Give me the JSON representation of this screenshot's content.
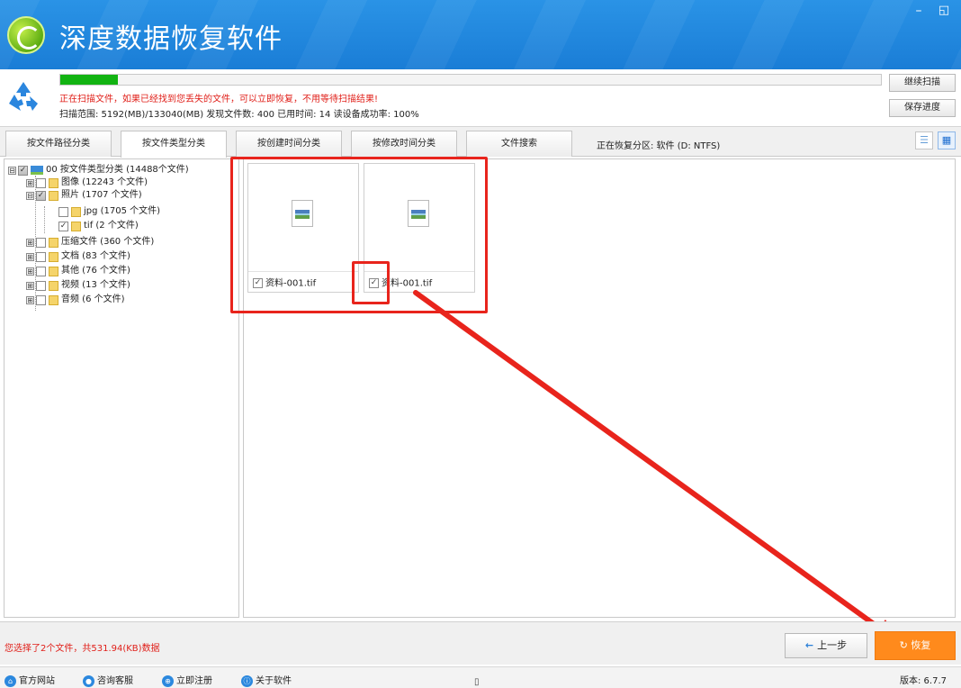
{
  "window": {
    "title": "深度数据恢复软件",
    "minimize_glyph": "–",
    "restore_glyph": "◱"
  },
  "scan": {
    "progress_percent": 7,
    "line1": "正在扫描文件，如果已经找到您丢失的文件，可以立即恢复，不用等待扫描结果!",
    "line2": "扫描范围: 5192(MB)/133040(MB)   发现文件数: 400   已用时间: 14   读设备成功率: 100%",
    "continue_label": "继续扫描",
    "save_label": "保存进度"
  },
  "tabs": [
    {
      "label": "按文件路径分类"
    },
    {
      "label": "按文件类型分类"
    },
    {
      "label": "按创建时间分类"
    },
    {
      "label": "按修改时间分类"
    },
    {
      "label": "文件搜索"
    }
  ],
  "partition_label": "正在恢复分区: 软件 (D: NTFS)",
  "view_icons": {
    "list": "☰",
    "grid": "▦"
  },
  "tree": [
    {
      "exp": "⊟",
      "check": "✓",
      "label": "00  按文件类型分类  (14488个文件)"
    },
    {
      "exp": "⊞",
      "check": "",
      "label": "图像  (12243 个文件)"
    },
    {
      "exp": "⊟",
      "check": "✓",
      "label": "照片  (1707 个文件)"
    },
    {
      "exp": "",
      "check": "",
      "label": "jpg  (1705 个文件)"
    },
    {
      "exp": "",
      "check": "✓",
      "label": "tif  (2 个文件)"
    },
    {
      "exp": "⊞",
      "check": "",
      "label": "压缩文件  (360 个文件)"
    },
    {
      "exp": "⊞",
      "check": "",
      "label": "文档  (83 个文件)"
    },
    {
      "exp": "⊞",
      "check": "",
      "label": "其他  (76 个文件)"
    },
    {
      "exp": "⊞",
      "check": "",
      "label": "视频  (13 个文件)"
    },
    {
      "exp": "⊞",
      "check": "",
      "label": "音频  (6 个文件)"
    }
  ],
  "files": [
    {
      "name": "资料-001.tif",
      "check": "✓"
    },
    {
      "name": "资料-001.tif",
      "check": "✓"
    }
  ],
  "bottom": {
    "selected_info": "您选择了2个文件，共531.94(KB)数据",
    "prev_arrow": "←",
    "prev_label": "上一步",
    "recover_icon": "↻",
    "recover_label": "恢复"
  },
  "footer": {
    "links": [
      {
        "icon": "⌂",
        "label": "官方网站"
      },
      {
        "icon": "●",
        "label": "咨询客服"
      },
      {
        "icon": "⊕",
        "label": "立即注册"
      },
      {
        "icon": "ⓘ",
        "label": "关于软件"
      }
    ],
    "version": "版本: 6.7.7",
    "stray_glyph": "▯"
  },
  "colors": {
    "header": "#1a7dd6",
    "warning_text": "#e0201a",
    "progress": "#12b312",
    "recover_button": "#ff8a1c",
    "highlight": "#e8241c"
  }
}
